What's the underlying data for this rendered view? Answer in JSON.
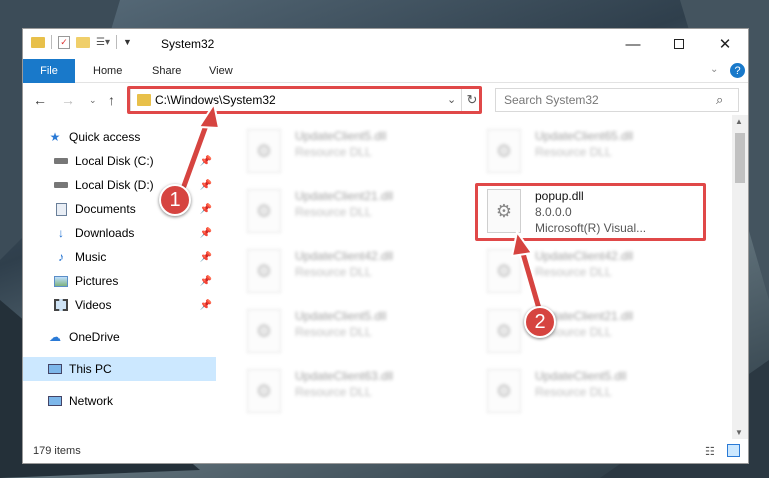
{
  "window": {
    "title": "System32"
  },
  "ribbon": {
    "tabs": [
      "File",
      "Home",
      "Share",
      "View"
    ]
  },
  "address": {
    "path": "C:\\Windows\\System32",
    "search_placeholder": "Search System32"
  },
  "sidebar": {
    "items": [
      {
        "label": "Quick access",
        "icon": "star-icon"
      },
      {
        "label": "Local Disk (C:)",
        "icon": "drive-icon"
      },
      {
        "label": "Local Disk (D:)",
        "icon": "drive-icon"
      },
      {
        "label": "Documents",
        "icon": "documents-icon"
      },
      {
        "label": "Downloads",
        "icon": "downloads-icon"
      },
      {
        "label": "Music",
        "icon": "music-icon"
      },
      {
        "label": "Pictures",
        "icon": "pictures-icon"
      },
      {
        "label": "Videos",
        "icon": "videos-icon"
      },
      {
        "label": "OneDrive",
        "icon": "cloud-icon"
      },
      {
        "label": "This PC",
        "icon": "computer-icon"
      },
      {
        "label": "Network",
        "icon": "network-icon"
      }
    ]
  },
  "files": [
    {
      "name": "UpdateClient5.dll",
      "desc": "Resource DLL"
    },
    {
      "name": "UpdateClient65.dll",
      "desc": "Resource DLL"
    },
    {
      "name": "UpdateClient21.dll",
      "desc": "Resource DLL"
    },
    {
      "name": "popup.dll",
      "version": "8.0.0.0",
      "desc": "Microsoft(R) Visual..."
    },
    {
      "name": "UpdateClient42.dll",
      "desc": "Resource DLL"
    },
    {
      "name": "UpdateClient42.dll",
      "desc": "Resource DLL"
    },
    {
      "name": "UpdateClient5.dll",
      "desc": "Resource DLL"
    },
    {
      "name": "UpdateClient21.dll",
      "desc": "Resource DLL"
    },
    {
      "name": "UpdateClient63.dll",
      "desc": "Resource DLL"
    },
    {
      "name": "UpdateClient5.dll",
      "desc": "Resource DLL"
    }
  ],
  "status": {
    "items_count": "179 items"
  },
  "steps": [
    "1",
    "2"
  ],
  "colors": {
    "accent": "#1979ca",
    "highlight": "#e04848",
    "badge": "#d64440",
    "selected": "#cce8ff"
  }
}
